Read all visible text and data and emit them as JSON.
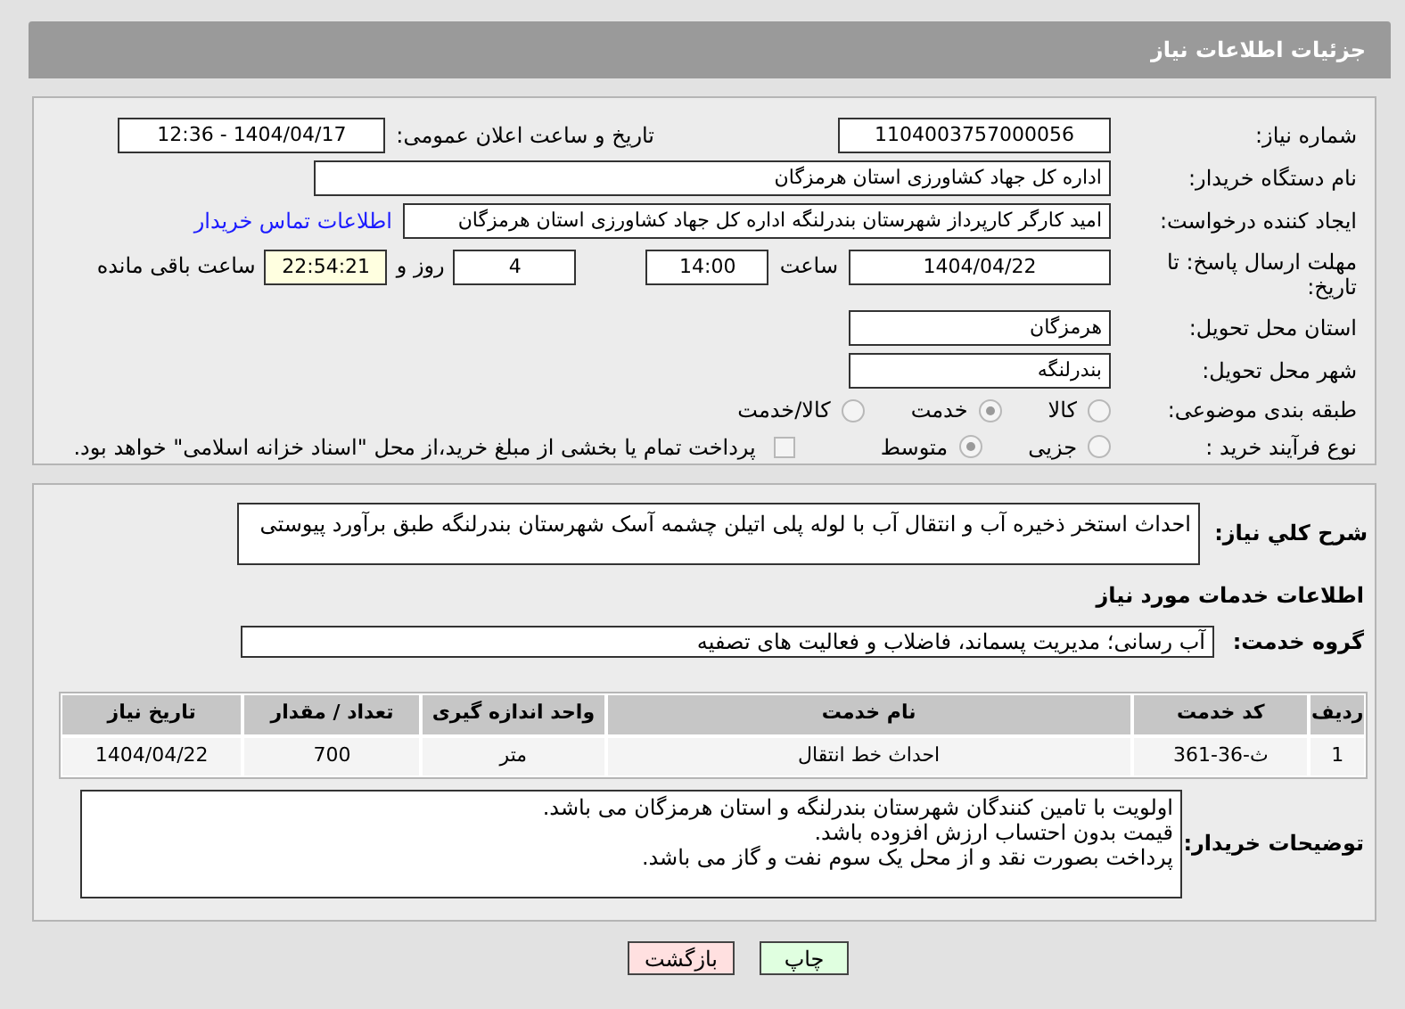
{
  "header": {
    "title": "جزئیات اطلاعات نیاز"
  },
  "need_number": {
    "label": "شماره نیاز:",
    "value": "1104003757000056"
  },
  "announce_date": {
    "label": "تاریخ و ساعت اعلان عمومی:",
    "value": "1404/04/17 - 12:36"
  },
  "buyer_org": {
    "label": "نام دستگاه خریدار:",
    "value": "اداره کل جهاد کشاورزی استان هرمزگان"
  },
  "requester": {
    "label": "ایجاد کننده درخواست:",
    "value": "امید کارگر کارپرداز شهرستان بندرلنگه اداره کل جهاد کشاورزی استان هرمزگان",
    "link": "اطلاعات تماس خریدار"
  },
  "deadline": {
    "label": "مهلت ارسال پاسخ: تا تاریخ:",
    "date": "1404/04/22",
    "time_label": "ساعت",
    "time": "14:00",
    "days": "4",
    "days_label": "روز و",
    "remaining": "22:54:21",
    "remaining_label": "ساعت باقی مانده"
  },
  "province": {
    "label": "استان محل تحویل:",
    "value": "هرمزگان"
  },
  "city": {
    "label": "شهر محل تحویل:",
    "value": "بندرلنگه"
  },
  "category": {
    "label": "طبقه بندی موضوعی:",
    "options": [
      {
        "label": "کالا",
        "selected": false
      },
      {
        "label": "خدمت",
        "selected": true
      },
      {
        "label": "کالا/خدمت",
        "selected": false
      }
    ]
  },
  "process": {
    "label": "نوع فرآیند خرید :",
    "options": [
      {
        "label": "جزیی",
        "selected": false
      },
      {
        "label": "متوسط",
        "selected": true
      }
    ],
    "payment_note": {
      "label": "پرداخت تمام یا بخشی از مبلغ خرید،از محل \"اسناد خزانه اسلامی\" خواهد بود.",
      "checked": false
    }
  },
  "summary": {
    "label": "شرح کلي نياز:",
    "value": "احداث استخر ذخیره آب و انتقال آب با لوله پلی اتیلن چشمه آسک شهرستان بندرلنگه طبق برآورد پیوستی"
  },
  "services_heading": "اطلاعات خدمات مورد نیاز",
  "service_group": {
    "label": "گروه خدمت:",
    "value": "آب رسانی؛ مدیریت پسماند، فاضلاب و فعالیت های تصفیه"
  },
  "table": {
    "columns": [
      "ردیف",
      "کد خدمت",
      "نام خدمت",
      "واحد اندازه گیری",
      "تعداد / مقدار",
      "تاریخ نیاز"
    ],
    "rows": [
      [
        "1",
        "ث-36-361",
        "احداث خط انتقال",
        "متر",
        "700",
        "1404/04/22"
      ]
    ]
  },
  "buyer_notes": {
    "label": "توضیحات خریدار:",
    "lines": [
      "اولویت با تامین کنندگان شهرستان بندرلنگه و استان هرمزگان می باشد.",
      "قیمت بدون احتساب ارزش افزوده باشد.",
      "پرداخت بصورت نقد و از محل یک سوم نفت و گاز می باشد."
    ]
  },
  "buttons": [
    {
      "kind": "print",
      "label": "چاپ"
    },
    {
      "kind": "back",
      "label": "بازگشت"
    }
  ]
}
